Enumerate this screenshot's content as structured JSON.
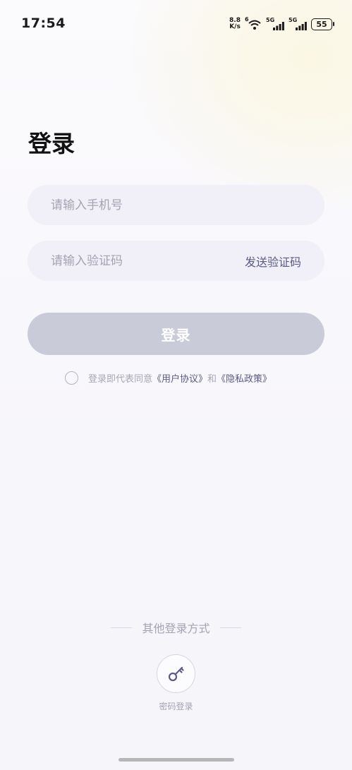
{
  "status_bar": {
    "time": "17:54",
    "net_speed_value": "8.8",
    "net_speed_unit": "K/s",
    "wifi_badge": "6",
    "signal_1_label": "5G",
    "signal_2_label": "5G",
    "battery": "55"
  },
  "login": {
    "title": "登录",
    "phone_placeholder": "请输入手机号",
    "code_placeholder": "请输入验证码",
    "send_code_label": "发送验证码",
    "submit_label": "登录",
    "agreement_prefix": "登录即代表同意",
    "user_agreement_link": "《用户协议》",
    "agreement_and": "和",
    "privacy_policy_link": "《隐私政策》"
  },
  "other_login": {
    "label": "其他登录方式",
    "password_login_label": "密码登录"
  },
  "colors": {
    "accent": "#5b5a86",
    "button_disabled": "#c9ccd8",
    "input_bg": "#f1f0f8"
  }
}
